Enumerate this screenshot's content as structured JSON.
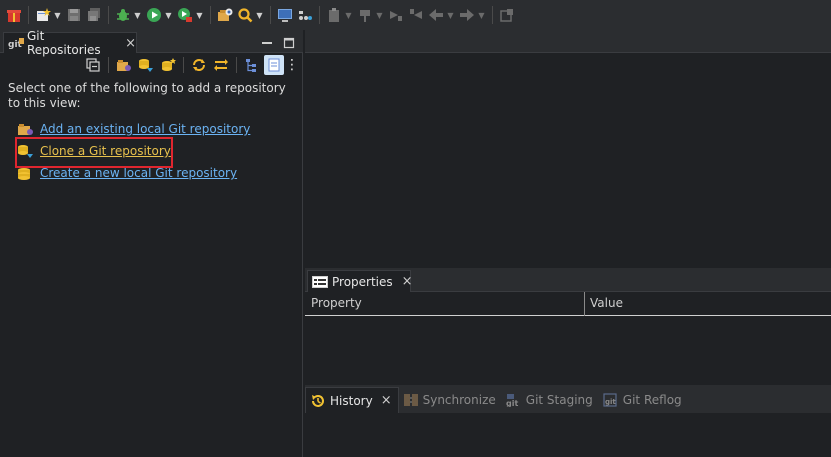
{
  "main_toolbar": {
    "buttons": [
      "gift-icon",
      "new-icon",
      "save-icon",
      "save-all-icon",
      "debug-icon",
      "run-icon",
      "run-external-icon",
      "open-task-icon",
      "search-icon",
      "console-icon",
      "link-icon",
      "clipboard-icon",
      "pin-icon",
      "next-annotation-icon",
      "prev-annotation-icon",
      "back-icon",
      "forward-icon",
      "maximize-icon"
    ]
  },
  "git_repositories_view": {
    "tab_label": "Git Repositories",
    "close_glyph": "×",
    "more_glyph": "⋮",
    "intro_text": "Select one of the following to add a repository to this view:",
    "links": [
      {
        "label": "Add an existing local Git repository",
        "icon": "folder-git-icon"
      },
      {
        "label": "Clone a Git repository",
        "icon": "clone-repo-icon"
      },
      {
        "label": "Create a new local Git repository",
        "icon": "create-repo-icon"
      }
    ]
  },
  "properties_view": {
    "tab_label": "Properties",
    "close_glyph": "×",
    "columns": [
      "Property",
      "Value"
    ]
  },
  "bottom_tabs": {
    "tabs": [
      {
        "label": "History",
        "active": true
      },
      {
        "label": "Synchronize",
        "active": false
      },
      {
        "label": "Git Staging",
        "active": false
      },
      {
        "label": "Git Reflog",
        "active": false
      }
    ],
    "close_glyph": "×"
  },
  "colors": {
    "link": "#6bb3f3",
    "link_highlighted": "#e8c14d",
    "highlight_box": "#e0262f",
    "background": "#1f2124",
    "toolbar": "#2b2d30"
  }
}
